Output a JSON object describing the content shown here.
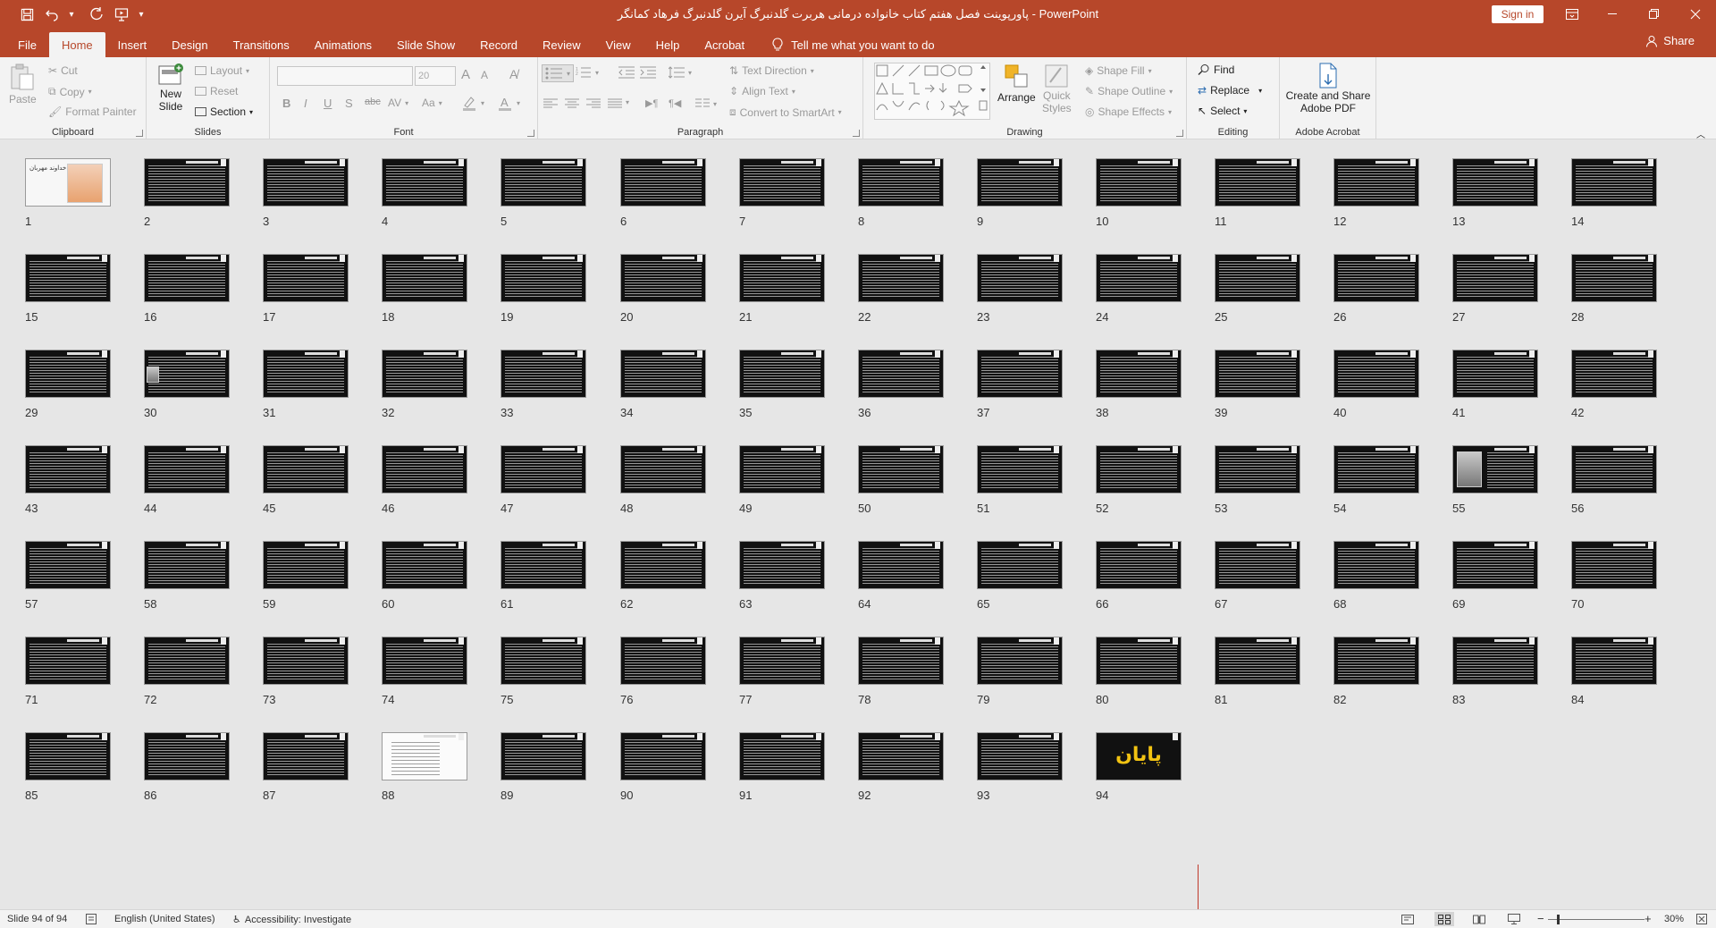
{
  "app": {
    "title": "پاورپوینت فصل هفتم کتاب خانواده درمانی هربرت گلدنبرگ آیرن گلدنبرگ فرهاد کمانگر  -  PowerPoint",
    "signin_label": "Sign in"
  },
  "tabs": [
    "File",
    "Home",
    "Insert",
    "Design",
    "Transitions",
    "Animations",
    "Slide Show",
    "Record",
    "Review",
    "View",
    "Help",
    "Acrobat"
  ],
  "active_tab": "Home",
  "tellme": "Tell me what you want to do",
  "share_label": "Share",
  "ribbon": {
    "clipboard": {
      "label": "Clipboard",
      "paste": "Paste",
      "cut": "Cut",
      "copy": "Copy",
      "format_painter": "Format Painter"
    },
    "slides": {
      "label": "Slides",
      "new_slide_1": "New",
      "new_slide_2": "Slide",
      "layout": "Layout",
      "reset": "Reset",
      "section": "Section"
    },
    "font": {
      "label": "Font",
      "font_size": "20",
      "bold": "B",
      "italic": "I",
      "underline": "U",
      "shadow": "S",
      "strike": "abc",
      "spacing": "AV",
      "case": "Aa",
      "grow": "A",
      "shrink": "A"
    },
    "paragraph": {
      "label": "Paragraph",
      "text_direction": "Text Direction",
      "align_text": "Align Text",
      "convert_smartart": "Convert to SmartArt"
    },
    "drawing": {
      "label": "Drawing",
      "arrange": "Arrange",
      "quick_styles_1": "Quick",
      "quick_styles_2": "Styles",
      "shape_fill": "Shape Fill",
      "shape_outline": "Shape Outline",
      "shape_effects": "Shape Effects"
    },
    "editing": {
      "label": "Editing",
      "find": "Find",
      "replace": "Replace",
      "select": "Select"
    },
    "acrobat": {
      "label": "Adobe Acrobat",
      "create_1": "Create and Share",
      "create_2": "Adobe PDF"
    }
  },
  "slides": {
    "count": 94,
    "per_row": 14,
    "title_slide_text": "بنام خداوند مهربان",
    "end_slide_text": "پایان",
    "photo_slides": [
      30,
      55
    ],
    "light_slides": [
      88
    ]
  },
  "status": {
    "slide_info": "Slide 94 of 94",
    "language": "English (United States)",
    "accessibility": "Accessibility: Investigate",
    "zoom": "30%",
    "zoom_minus": "−",
    "zoom_plus": "+"
  }
}
